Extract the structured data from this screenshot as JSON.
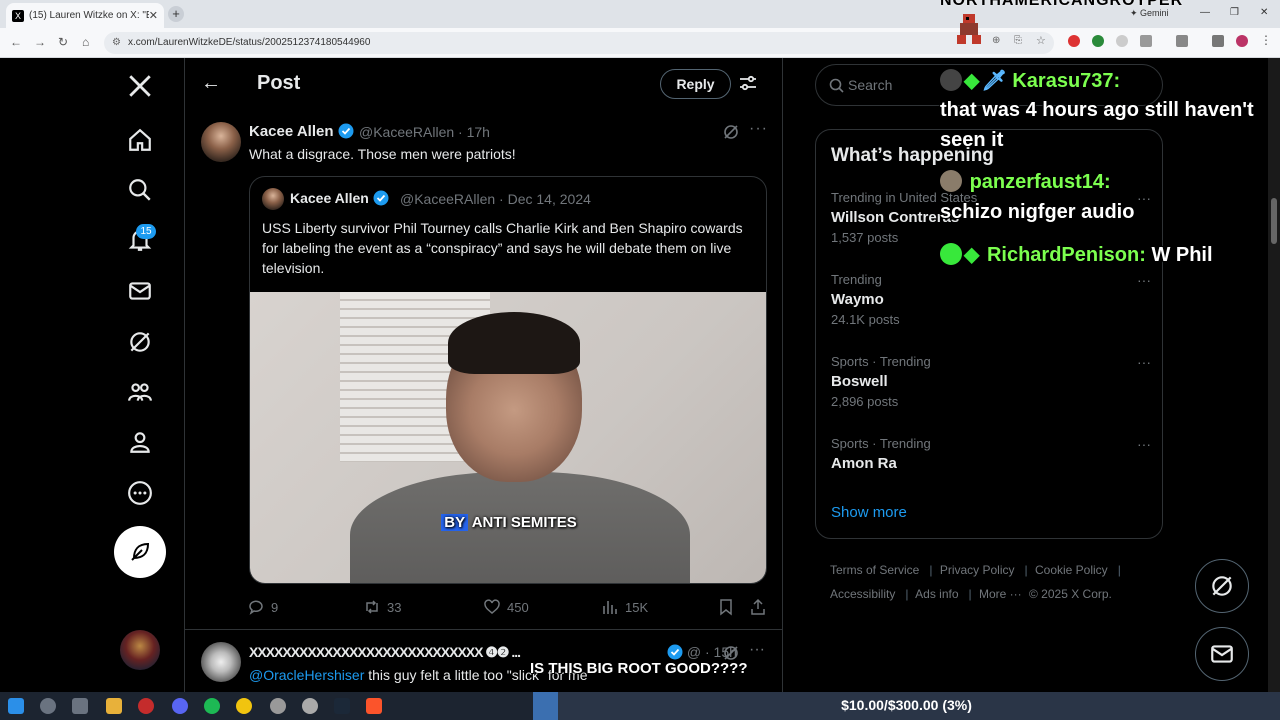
{
  "browser": {
    "tab_title": "(15) Lauren Witzke on X: \"E",
    "tab_close": "✕",
    "new_tab": "+",
    "url": "x.com/LaurenWitzkeDE/status/2002512374180544960",
    "gemini_label": "Gemini",
    "favicon": "X"
  },
  "overlay_top": {
    "streamer_name": "NORTHAMERICANGROYPER"
  },
  "nav": {
    "notifications_badge": "15",
    "logo": "X"
  },
  "header": {
    "title": "Post",
    "reply_button": "Reply",
    "back_icon": "←"
  },
  "tweet": {
    "author": "Kacee Allen",
    "handle": "@KaceeRAllen",
    "time": "17h",
    "text": "What a disgrace. Those men were patriots!",
    "more": "···",
    "quote": {
      "author": "Kacee Allen",
      "handle": "@KaceeRAllen",
      "date": "Dec 14, 2024",
      "text": "USS Liberty survivor Phil Tourney calls Charlie Kirk and Ben Shapiro cowards for labeling the event as a “conspiracy” and says he will debate them on live television.",
      "video_caption_highlight": "BY",
      "video_caption_rest": "ANTI SEMITES"
    },
    "stats": {
      "replies": "9",
      "reposts": "33",
      "likes": "450",
      "views": "15K"
    }
  },
  "tweet2": {
    "author_masked": "XXXXXXXXXXXXXXXXXXXXXXXXXXXX",
    "author_badges": "❹❷ ...",
    "handle": "@ ·",
    "time": "15h",
    "mention": "@OracleHershiser",
    "text": " this guy felt a little too \"slick\" for me"
  },
  "sidebar": {
    "search_placeholder": "Search",
    "happening_title": "What’s happening",
    "trends": [
      {
        "context": "Trending in United States",
        "title": "Willson Contreras",
        "count": "1,537 posts"
      },
      {
        "context": "Trending",
        "title": "Waymo",
        "count": "24.1K posts"
      },
      {
        "context": "Sports · Trending",
        "title": "Boswell",
        "count": "2,896 posts"
      },
      {
        "context": "Sports · Trending",
        "title": "Amon Ra",
        "count": ""
      }
    ],
    "trend_more": "···",
    "show_more": "Show more",
    "footer": {
      "terms": "Terms of Service",
      "privacy": "Privacy Policy",
      "cookie": "Cookie Policy",
      "accessibility": "Accessibility",
      "ads": "Ads info",
      "more": "More ···",
      "copyright": "© 2025 X Corp."
    }
  },
  "chat": [
    {
      "user": "Karasu737:",
      "message": "that was 4 hours ago still haven't",
      "message2": "seen it"
    },
    {
      "user": "panzerfaust14:",
      "message": "schizo nigfger audio"
    },
    {
      "user": "RichardPenison:",
      "message": "W Phil"
    }
  ],
  "stream_overlay": {
    "question": "IS THIS BIG ROOT GOOD????",
    "goal_text": "$10.00/$300.00 (3%)",
    "goal_fraction": 0.0333
  },
  "colors": {
    "accent": "#1d9bf0",
    "background": "#000000",
    "border": "#2f3336",
    "muted": "#71767b",
    "chat_user": "#7cff4f"
  }
}
